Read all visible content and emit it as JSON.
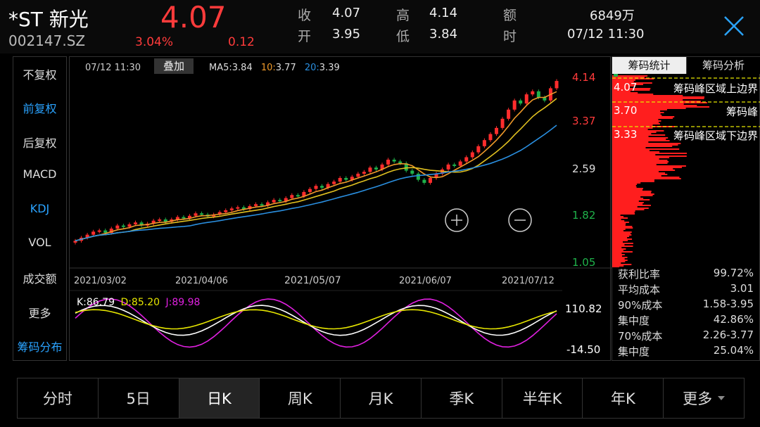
{
  "header": {
    "name": "*ST 新光",
    "code": "002147.SZ",
    "price": "4.07",
    "change_pct": "3.04%",
    "change": "0.12",
    "quote": [
      {
        "label": "收",
        "value": "4.07"
      },
      {
        "label": "高",
        "value": "4.14"
      },
      {
        "label": "额",
        "value": "6849万"
      },
      {
        "label": "开",
        "value": "3.95"
      },
      {
        "label": "低",
        "value": "3.84"
      },
      {
        "label": "时",
        "value": "07/12 11:30"
      }
    ]
  },
  "left_menu": [
    {
      "label": "不复权",
      "active": false
    },
    {
      "label": "前复权",
      "active": true
    },
    {
      "label": "后复权",
      "active": false
    },
    {
      "label": "MACD",
      "active": false
    },
    {
      "label": "KDJ",
      "active": true
    },
    {
      "label": "VOL",
      "active": false
    },
    {
      "label": "成交额",
      "active": false
    },
    {
      "label": "更多",
      "active": false
    },
    {
      "label": "筹码分布",
      "active": true
    }
  ],
  "chart_toolbar": {
    "time": "07/12 11:30",
    "overlay_button": "叠加",
    "ma5_label": "MA5:",
    "ma5_value": "3.84",
    "ma10_label": "10:",
    "ma10_value": "3.77",
    "ma20_label": "20:",
    "ma20_value": "3.39"
  },
  "kdj": {
    "k": "K:86.79",
    "d": "D:85.20",
    "j": "J:89.98",
    "top": "110.82",
    "bottom": "-14.50"
  },
  "chip_panel": {
    "tabs": [
      "筹码统计",
      "筹码分析"
    ],
    "levels": [
      {
        "price": "4.07",
        "label": "筹码峰区域上边界"
      },
      {
        "price": "3.70",
        "label": "筹码峰"
      },
      {
        "price": "3.33",
        "label": "筹码峰区域下边界"
      }
    ],
    "stats": [
      {
        "label": "获利比率",
        "value": "99.72%"
      },
      {
        "label": "平均成本",
        "value": "3.01"
      },
      {
        "label": "90%成本",
        "value": "1.58-3.95"
      },
      {
        "label": "集中度",
        "value": "42.86%"
      },
      {
        "label": "70%成本",
        "value": "2.26-3.77"
      },
      {
        "label": "集中度",
        "value": "25.04%"
      }
    ]
  },
  "bottom_tabs": [
    "分时",
    "5日",
    "日K",
    "周K",
    "月K",
    "季K",
    "半年K",
    "年K",
    "更多"
  ],
  "colors": {
    "up": "#ff2d2d",
    "down": "#1fb24a",
    "ma5": "#f09a2a",
    "ma10": "#e0c020",
    "ma20": "#2a8fe0",
    "accent": "#2aa3ff"
  },
  "chart_data": {
    "type": "candlestick",
    "y_ticks": [
      "4.14",
      "3.37",
      "2.59",
      "1.82",
      "1.05"
    ],
    "ylim": [
      1.05,
      4.14
    ],
    "x_ticks": [
      "2021/03/02",
      "2021/04/06",
      "2021/05/07",
      "2021/06/07",
      "2021/07/12"
    ],
    "close": [
      1.45,
      1.5,
      1.55,
      1.6,
      1.62,
      1.58,
      1.65,
      1.7,
      1.68,
      1.72,
      1.75,
      1.7,
      1.73,
      1.78,
      1.8,
      1.76,
      1.8,
      1.84,
      1.82,
      1.86,
      1.9,
      1.88,
      1.85,
      1.88,
      1.92,
      1.95,
      1.98,
      2.0,
      1.97,
      2.02,
      2.05,
      2.03,
      2.08,
      2.12,
      2.1,
      2.15,
      2.2,
      2.18,
      2.25,
      2.3,
      2.35,
      2.32,
      2.38,
      2.42,
      2.48,
      2.45,
      2.5,
      2.55,
      2.58,
      2.65,
      2.62,
      2.7,
      2.78,
      2.75,
      2.72,
      2.6,
      2.55,
      2.45,
      2.4,
      2.48,
      2.55,
      2.62,
      2.7,
      2.68,
      2.75,
      2.82,
      2.9,
      3.0,
      3.1,
      3.2,
      3.3,
      3.45,
      3.6,
      3.75,
      3.7,
      3.85,
      3.9,
      3.8,
      3.75,
      3.95,
      4.07
    ]
  }
}
